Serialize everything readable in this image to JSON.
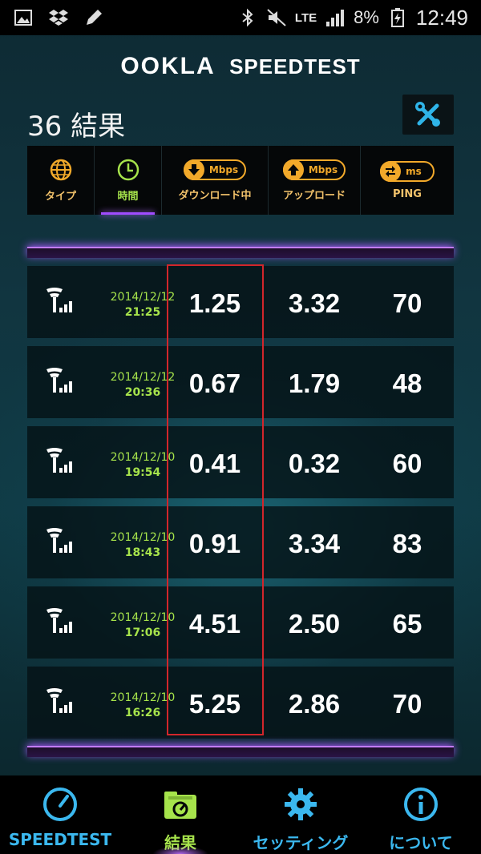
{
  "status_bar": {
    "battery": "8%",
    "network": "LTE",
    "time": "12:49"
  },
  "header": {
    "brand_left": "OOKLA",
    "brand_right": "SPEEDTEST",
    "results_title": "36 結果"
  },
  "sort_bar": {
    "items": [
      {
        "label": "タイプ",
        "icon": "globe-icon"
      },
      {
        "label": "時間",
        "icon": "clock-icon"
      },
      {
        "label": "ダウンロード中",
        "icon": "download-icon",
        "unit": "Mbps"
      },
      {
        "label": "アップロード",
        "icon": "upload-icon",
        "unit": "Mbps"
      },
      {
        "label": "PING",
        "icon": "ping-icon",
        "unit": "ms"
      }
    ]
  },
  "results": [
    {
      "date": "2014/12/12",
      "time": "21:25",
      "download": "1.25",
      "upload": "3.32",
      "ping": "70"
    },
    {
      "date": "2014/12/12",
      "time": "20:36",
      "download": "0.67",
      "upload": "1.79",
      "ping": "48"
    },
    {
      "date": "2014/12/10",
      "time": "19:54",
      "download": "0.41",
      "upload": "0.32",
      "ping": "60"
    },
    {
      "date": "2014/12/10",
      "time": "18:43",
      "download": "0.91",
      "upload": "3.34",
      "ping": "83"
    },
    {
      "date": "2014/12/10",
      "time": "17:06",
      "download": "4.51",
      "upload": "2.50",
      "ping": "65"
    },
    {
      "date": "2014/12/10",
      "time": "16:26",
      "download": "5.25",
      "upload": "2.86",
      "ping": "70"
    }
  ],
  "bottom_nav": {
    "items": [
      {
        "label": "SPEEDTEST",
        "icon": "speedometer-icon"
      },
      {
        "label": "結果",
        "icon": "results-folder-icon"
      },
      {
        "label": "セッティング",
        "icon": "gear-icon"
      },
      {
        "label": "について",
        "icon": "info-icon"
      }
    ]
  },
  "colors": {
    "accent_green": "#a6e34b",
    "accent_orange": "#f2a92a",
    "accent_blue": "#3bb8ef",
    "accent_purple": "#a04cff"
  }
}
